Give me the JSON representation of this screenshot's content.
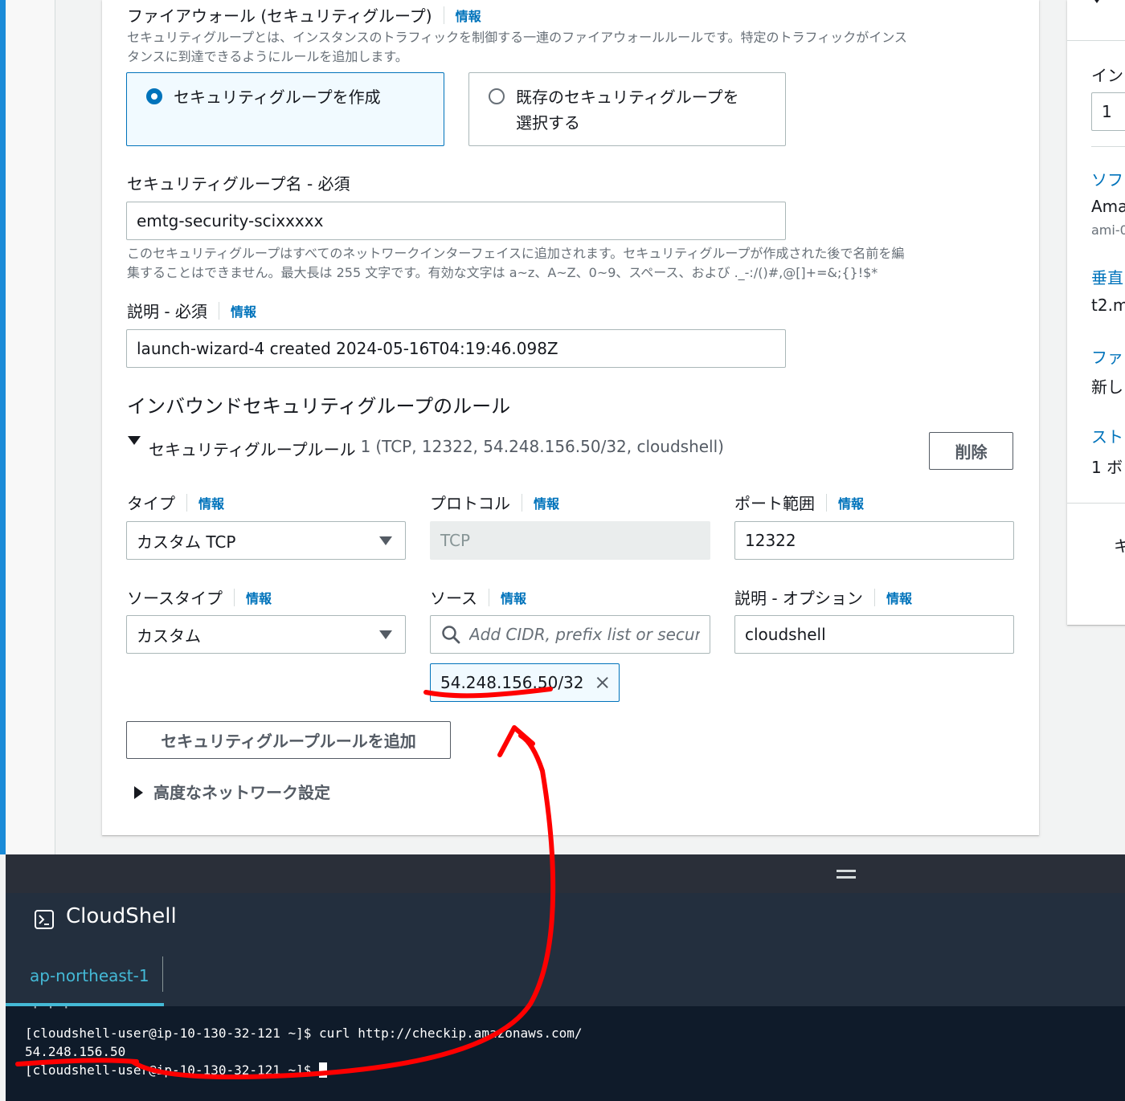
{
  "firewall": {
    "title": "ファイアウォール (セキュリティグループ)",
    "info": "情報",
    "desc_line1": "セキュリティグループとは、インスタンスのトラフィックを制御する一連のファイアウォールルールです。特定のトラフィックがインス",
    "desc_line2": "タンスに到達できるようにルールを追加します。",
    "option_create": "セキュリティグループを作成",
    "option_existing_line1": "既存のセキュリティグループを",
    "option_existing_line2": "選択する",
    "selected_option": "create"
  },
  "sg_name": {
    "label": "セキュリティグループ名 - 必須",
    "value": "emtg-security-scixxxxx",
    "hint_line1": "このセキュリティグループはすべてのネットワークインターフェイスに追加されます。セキュリティグループが作成された後で名前を編",
    "hint_line2": "集することはできません。最大長は 255 文字です。有効な文字は a~z、A~Z、0~9、スペース、および ._-:/()#,@[]+=&;{}!$*"
  },
  "description": {
    "label": "説明 - 必須",
    "info": "情報",
    "value": "launch-wizard-4 created 2024-05-16T04:19:46.098Z"
  },
  "inbound": {
    "title": "インバウンドセキュリティグループのルール",
    "rule_title": "セキュリティグループルール",
    "rule_number": "1",
    "rule_summary": "(TCP, 12322, 54.248.156.50/32, cloudshell)",
    "delete_button": "削除",
    "type_label": "タイプ",
    "type_info": "情報",
    "type_value": "カスタム TCP",
    "protocol_label": "プロトコル",
    "protocol_info": "情報",
    "protocol_value": "TCP",
    "port_label": "ポート範囲",
    "port_info": "情報",
    "port_value": "12322",
    "source_type_label": "ソースタイプ",
    "source_type_info": "情報",
    "source_type_value": "カスタム",
    "source_label": "ソース",
    "source_info": "情報",
    "source_placeholder": "Add CIDR, prefix list or security",
    "source_token": "54.248.156.50/32",
    "desc_label": "説明 - オプション",
    "desc_info": "情報",
    "desc_value": "cloudshell",
    "add_rule_button": "セキュリティグループルールを追加",
    "advanced": "高度なネットワーク設定"
  },
  "right_panel": {
    "item1": "イン",
    "input_value": "1",
    "item2": "ソフ",
    "item2_value": "Ama",
    "item2_sub": "ami-0",
    "item3": "垂直",
    "item3_value": "t2.m",
    "item4": "ファ",
    "item4_value": "新し",
    "item5": "スト",
    "item5_value": "1 ボ",
    "bottom_char": "キ"
  },
  "cloudshell": {
    "title": "CloudShell",
    "tab": "ap-northeast-1",
    "line_partial": "·  ·  ·",
    "line1": "[cloudshell-user@ip-10-130-32-121 ~]$ curl http://checkip.amazonaws.com/",
    "line2": "54.248.156.50",
    "line3": "[cloudshell-user@ip-10-130-32-121 ~]$ "
  },
  "colors": {
    "accent": "#0073bb",
    "annotation": "#ff0000",
    "shell_bg": "#232f3e"
  }
}
